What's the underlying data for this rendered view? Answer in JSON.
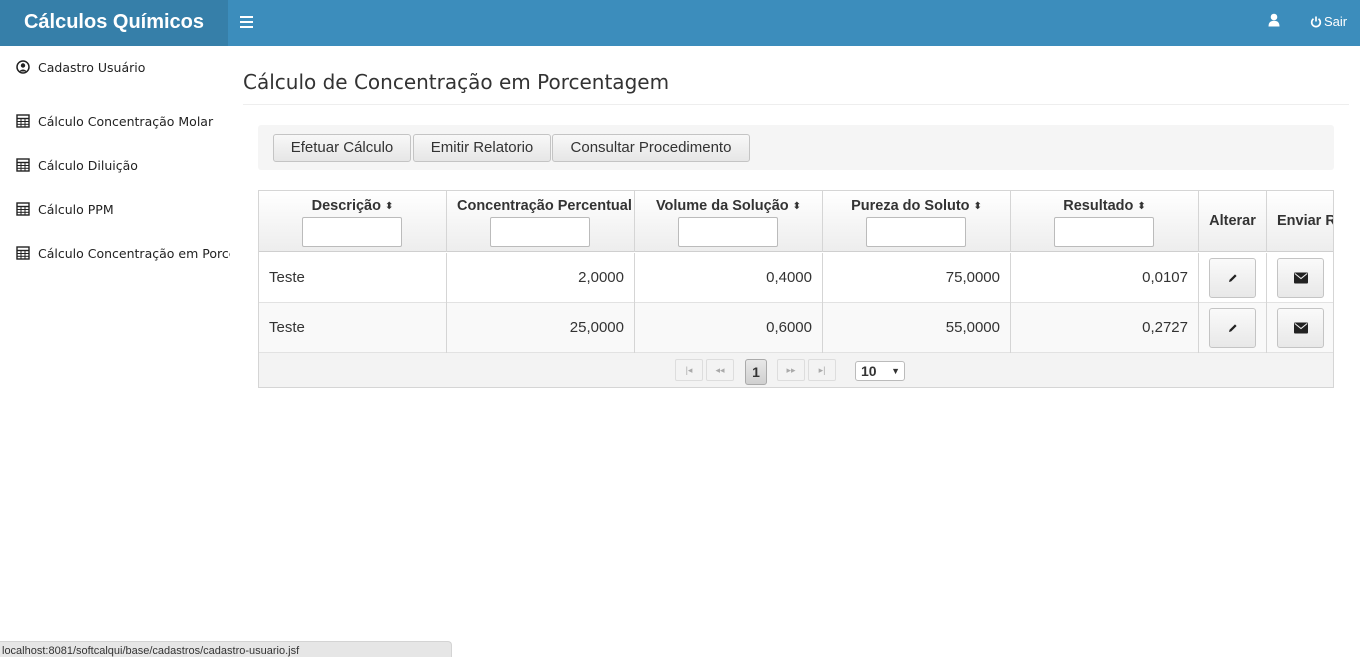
{
  "app": {
    "title": "Cálculos Químicos",
    "logout_label": "Sair"
  },
  "colors": {
    "header_bg": "#3c8dbc",
    "logo_bg": "#367fa9"
  },
  "icons": {
    "menu": "hamburger-icon",
    "user": "user-icon",
    "logout": "power-icon",
    "profile": "user-circle-icon",
    "calc": "calculator-icon",
    "edit": "pencil-icon",
    "send": "envelope-icon"
  },
  "sidebar": {
    "items": [
      {
        "label": "Cadastro Usuário",
        "icon": "user-circle-icon"
      },
      {
        "label": "Cálculo Concentração Molar",
        "icon": "calculator-icon"
      },
      {
        "label": "Cálculo Diluição",
        "icon": "calculator-icon"
      },
      {
        "label": "Cálculo PPM",
        "icon": "calculator-icon"
      },
      {
        "label": "Cálculo Concentração em Porcentagem",
        "icon": "calculator-icon"
      }
    ]
  },
  "page": {
    "title": "Cálculo de Concentração em Porcentagem"
  },
  "toolbar": {
    "calc_label": "Efetuar Cálculo",
    "report_label": "Emitir Relatorio",
    "procedure_label": "Consultar Procedimento"
  },
  "table": {
    "columns": [
      "Descrição",
      "Concentração Percentual",
      "Volume da Solução",
      "Pureza do Soluto",
      "Resultado",
      "Alterar",
      "Enviar Relatório"
    ],
    "rows": [
      {
        "descricao": "Teste",
        "concentracao": "2,0000",
        "volume": "0,4000",
        "pureza": "75,0000",
        "resultado": "0,0107"
      },
      {
        "descricao": "Teste",
        "concentracao": "25,0000",
        "volume": "0,6000",
        "pureza": "55,0000",
        "resultado": "0,2727"
      }
    ]
  },
  "pager": {
    "current_page": "1",
    "rows_per_page": "10"
  },
  "status_url": "localhost:8081/softcalqui/base/cadastros/cadastro-usuario.jsf"
}
